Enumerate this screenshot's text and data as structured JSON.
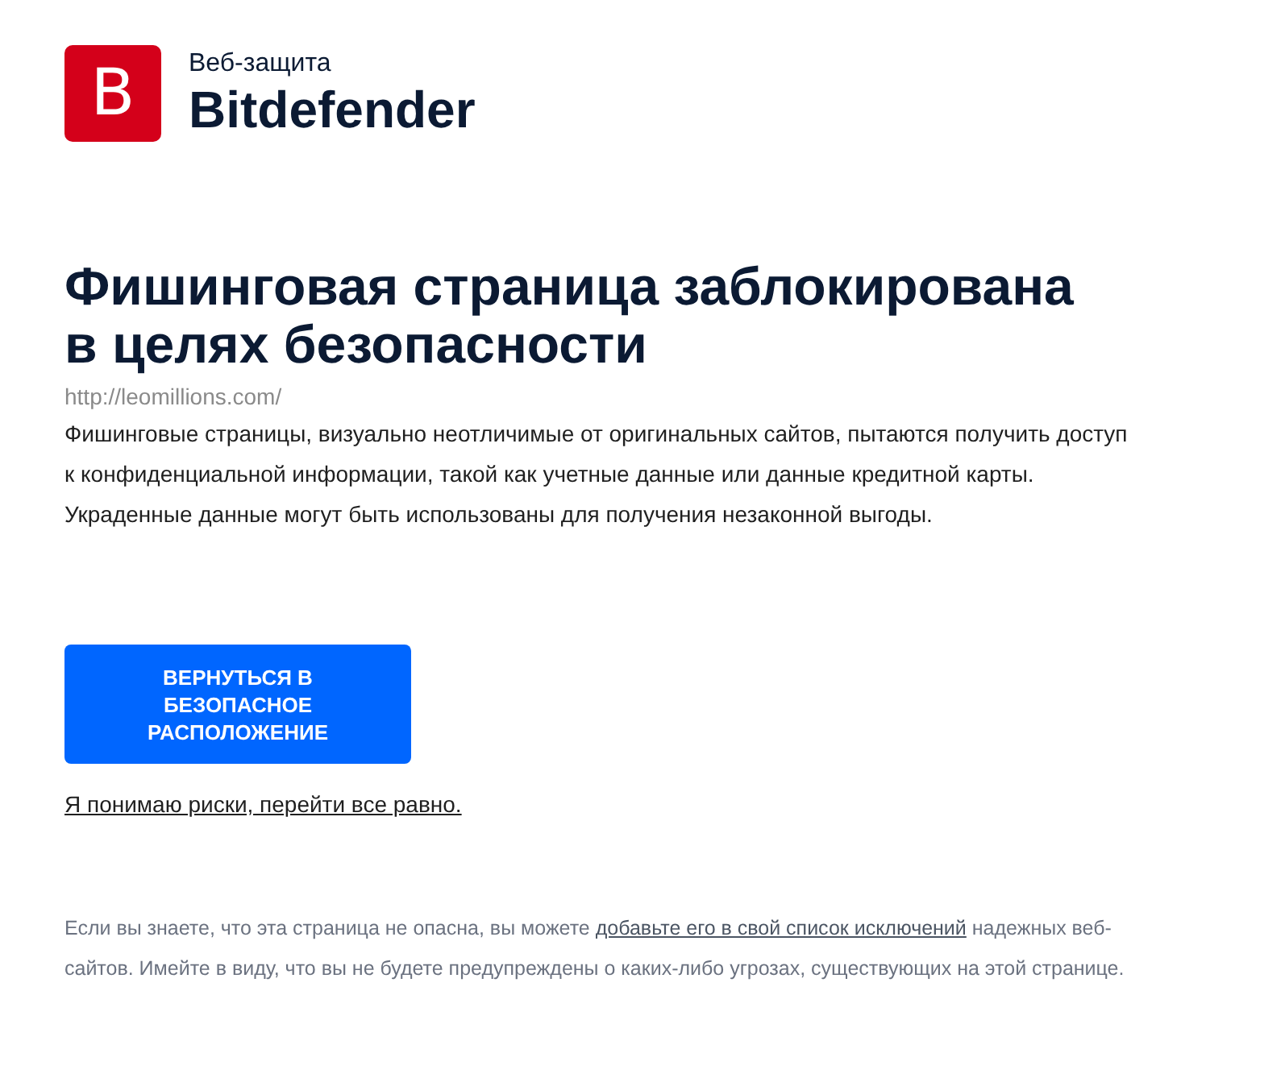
{
  "header": {
    "logo_letter": "B",
    "product": "Веб-защита",
    "brand": "Bitdefender"
  },
  "alert": {
    "title": "Фишинговая страница заблокирована в целях безопасности",
    "url": "http://leomillions.com/",
    "description": "Фишинговые страницы, визуально неотличимые от оригинальных сайтов, пытаются получить доступ к конфиденциальной информации, такой как учетные данные или данные кредитной карты. Украденные данные могут быть использованы для получения незаконной выгоды."
  },
  "actions": {
    "back_button": "ВЕРНУТЬСЯ В БЕЗОПАСНОЕ РАСПОЛОЖЕНИЕ",
    "proceed_link": "Я понимаю риски, перейти все равно."
  },
  "footer_note": {
    "text_before": "Если вы знаете, что эта страница не опасна, вы можете ",
    "link": "добавьте его в свой список исключений",
    "text_after": " надежных веб-сайтов. Имейте в виду, что вы не будете предупреждены о каких-либо угрозах, существующих на этой странице."
  }
}
